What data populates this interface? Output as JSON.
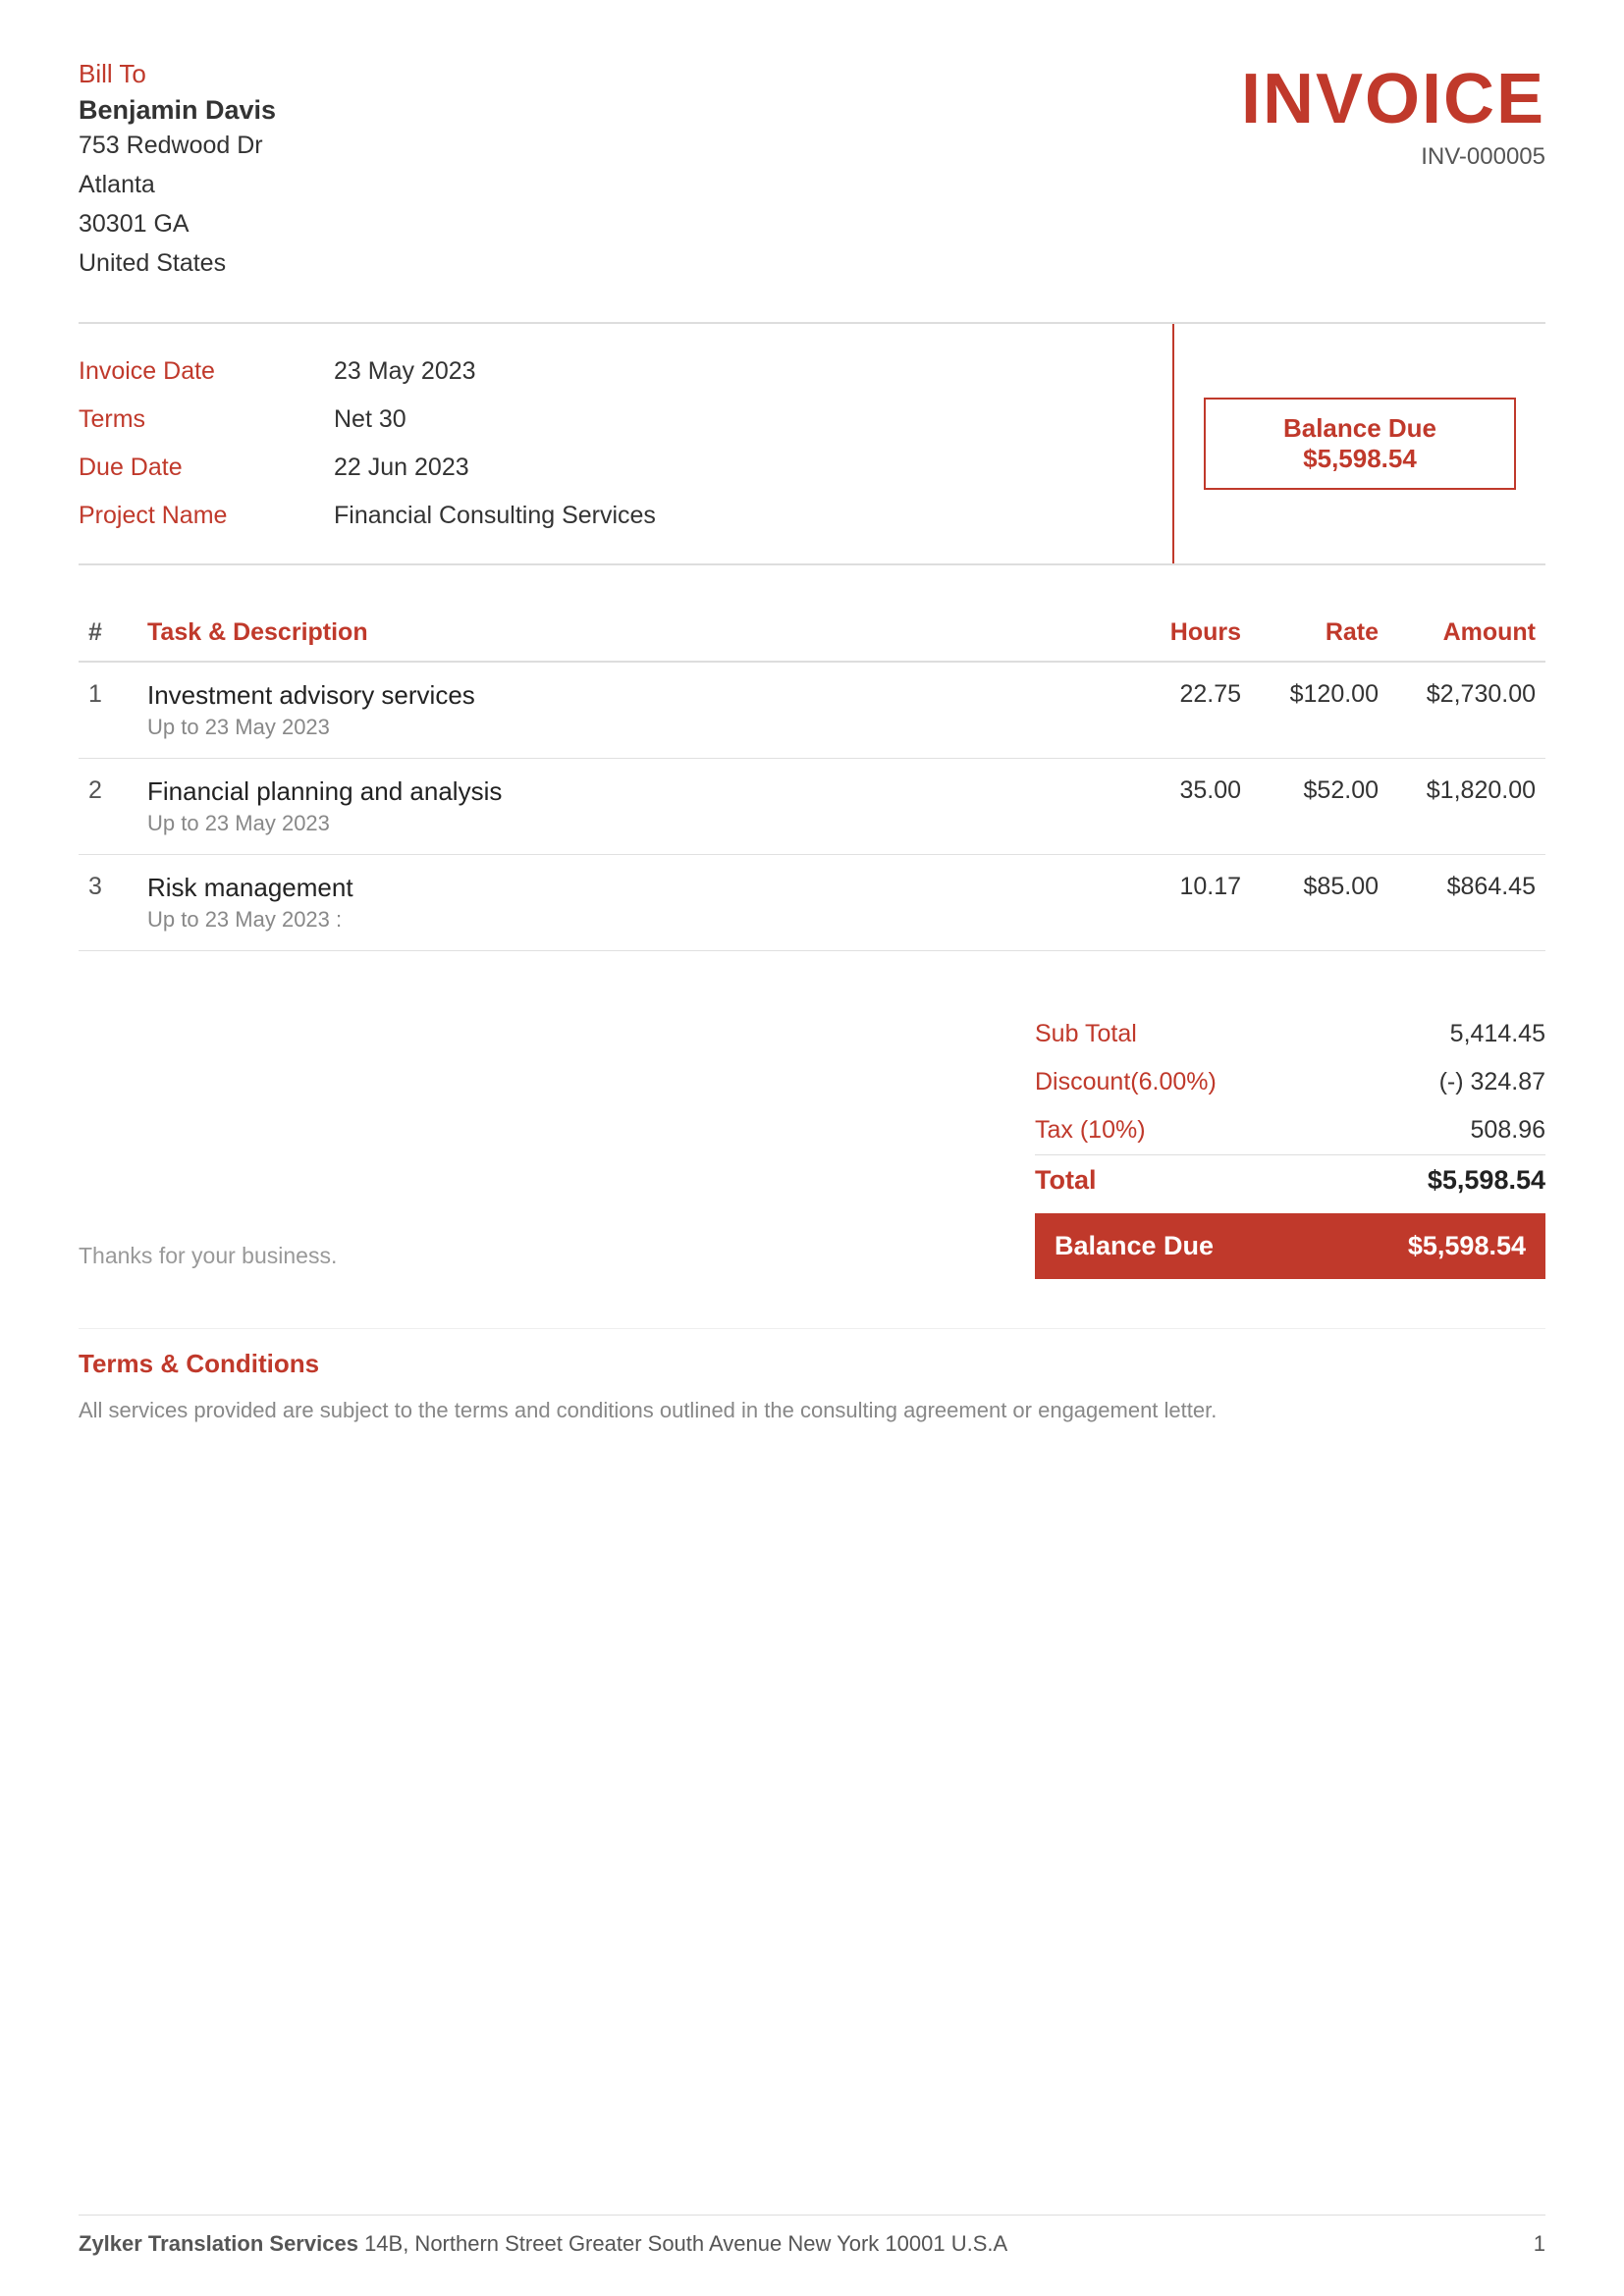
{
  "bill_to": {
    "label": "Bill To",
    "name": "Benjamin Davis",
    "address_line1": "753 Redwood Dr",
    "city": "Atlanta",
    "zip_state": "30301 GA",
    "country": "United States"
  },
  "invoice": {
    "title": "INVOICE",
    "number": "INV-000005"
  },
  "balance_due": {
    "label": "Balance Due",
    "amount": "$5,598.54"
  },
  "info": {
    "invoice_date_label": "Invoice Date",
    "invoice_date_value": "23 May 2023",
    "terms_label": "Terms",
    "terms_value": "Net 30",
    "due_date_label": "Due Date",
    "due_date_value": "22 Jun 2023",
    "project_name_label": "Project Name",
    "project_name_value": "Financial Consulting Services"
  },
  "table": {
    "headers": {
      "hash": "#",
      "task": "Task & Description",
      "hours": "Hours",
      "rate": "Rate",
      "amount": "Amount"
    },
    "rows": [
      {
        "num": "1",
        "task_main": "Investment advisory services",
        "task_sub": "Up to 23 May 2023",
        "hours": "22.75",
        "rate": "$120.00",
        "amount": "$2,730.00"
      },
      {
        "num": "2",
        "task_main": "Financial planning and analysis",
        "task_sub": "Up to 23 May 2023",
        "hours": "35.00",
        "rate": "$52.00",
        "amount": "$1,820.00"
      },
      {
        "num": "3",
        "task_main": "Risk management",
        "task_sub": "Up to 23 May 2023 :",
        "hours": "10.17",
        "rate": "$85.00",
        "amount": "$864.45"
      }
    ]
  },
  "thanks": "Thanks for your business.",
  "totals": {
    "subtotal_label": "Sub Total",
    "subtotal_value": "5,414.45",
    "discount_label": "Discount(6.00%)",
    "discount_value": "(-) 324.87",
    "tax_label": "Tax (10%)",
    "tax_value": "508.96",
    "total_label": "Total",
    "total_value": "$5,598.54",
    "balance_due_label": "Balance Due",
    "balance_due_value": "$5,598.54"
  },
  "terms": {
    "title": "Terms & Conditions",
    "text": "All services provided are subject to the terms and conditions outlined in the consulting agreement or engagement letter."
  },
  "footer": {
    "brand": "Zylker Translation Services",
    "address": "14B, Northern Street Greater South Avenue New York 10001 U.S.A",
    "page": "1"
  }
}
